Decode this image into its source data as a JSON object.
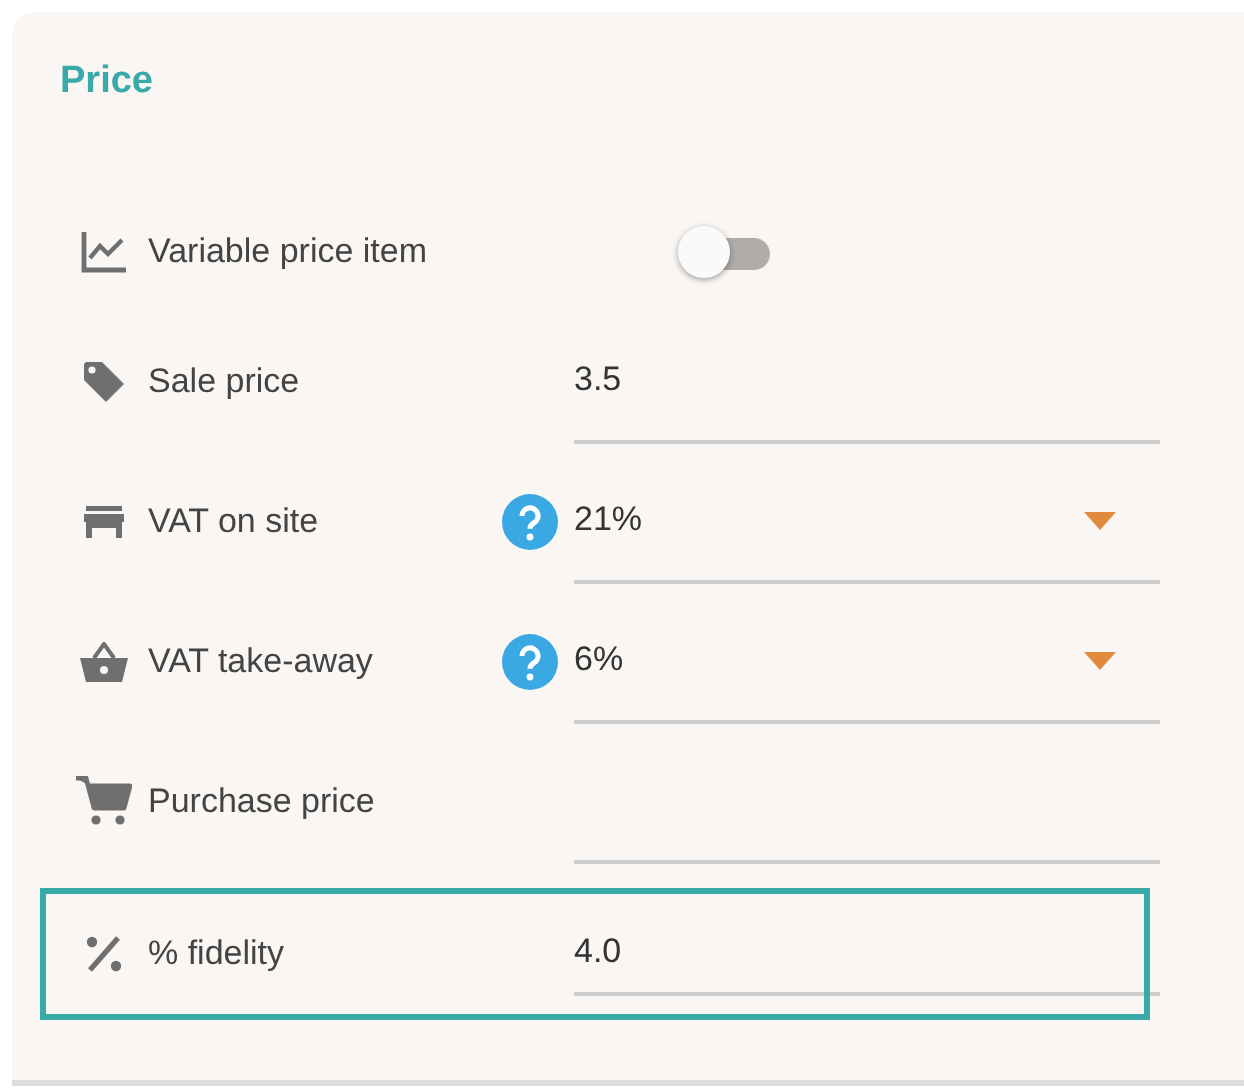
{
  "section": {
    "title": "Price"
  },
  "rows": [
    {
      "kind": "toggle",
      "label": "Variable price item",
      "on": false,
      "highlighted": false
    },
    {
      "kind": "input",
      "label": "Sale price",
      "value": "3.5",
      "highlighted": false
    },
    {
      "kind": "select",
      "label": "VAT on site",
      "value": "21%",
      "help": true,
      "highlighted": false
    },
    {
      "kind": "select",
      "label": "VAT take-away",
      "value": "6%",
      "help": true,
      "highlighted": false
    },
    {
      "kind": "input",
      "label": "Purchase price",
      "highlighted": false
    },
    {
      "kind": "input",
      "label": "% fidelity",
      "value": "4.0",
      "highlighted": true
    }
  ]
}
